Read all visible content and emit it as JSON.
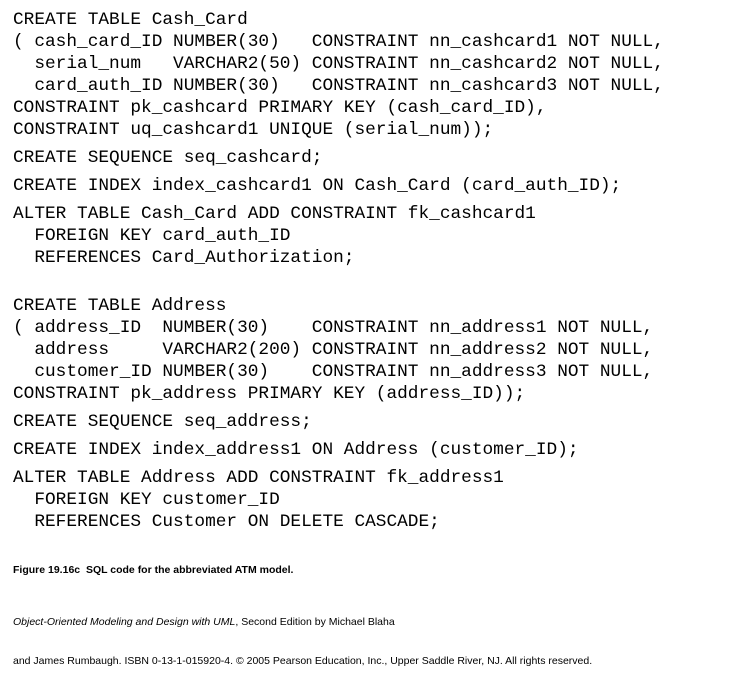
{
  "code_blocks": [
    {
      "lines": [
        "CREATE TABLE Cash_Card",
        "( cash_card_ID NUMBER(30)   CONSTRAINT nn_cashcard1 NOT NULL,",
        "  serial_num   VARCHAR2(50) CONSTRAINT nn_cashcard2 NOT NULL,",
        "  card_auth_ID NUMBER(30)   CONSTRAINT nn_cashcard3 NOT NULL,",
        "CONSTRAINT pk_cashcard PRIMARY KEY (cash_card_ID),",
        "CONSTRAINT uq_cashcard1 UNIQUE (serial_num));"
      ]
    },
    {
      "lines": [
        "CREATE SEQUENCE seq_cashcard;"
      ]
    },
    {
      "lines": [
        "CREATE INDEX index_cashcard1 ON Cash_Card (card_auth_ID);"
      ]
    },
    {
      "lines": [
        "ALTER TABLE Cash_Card ADD CONSTRAINT fk_cashcard1",
        "  FOREIGN KEY card_auth_ID",
        "  REFERENCES Card_Authorization;"
      ]
    },
    {
      "lines": [
        "CREATE TABLE Address",
        "( address_ID  NUMBER(30)    CONSTRAINT nn_address1 NOT NULL,",
        "  address     VARCHAR2(200) CONSTRAINT nn_address2 NOT NULL,",
        "  customer_ID NUMBER(30)    CONSTRAINT nn_address3 NOT NULL,",
        "CONSTRAINT pk_address PRIMARY KEY (address_ID));"
      ]
    },
    {
      "lines": [
        "CREATE SEQUENCE seq_address;"
      ]
    },
    {
      "lines": [
        "CREATE INDEX index_address1 ON Address (customer_ID);"
      ]
    },
    {
      "lines": [
        "ALTER TABLE Address ADD CONSTRAINT fk_address1",
        "  FOREIGN KEY customer_ID",
        "  REFERENCES Customer ON DELETE CASCADE;"
      ]
    }
  ],
  "caption": "Figure 19.16c  SQL code for the abbreviated ATM model.",
  "credit": {
    "book_title": "Object-Oriented Modeling and Design with UML",
    "line1_rest": ", Second Edition by Michael Blaha",
    "line2": "and James Rumbaugh. ISBN 0-13-1-015920-4. © 2005 Pearson Education, Inc., Upper Saddle River, NJ. All rights reserved."
  }
}
